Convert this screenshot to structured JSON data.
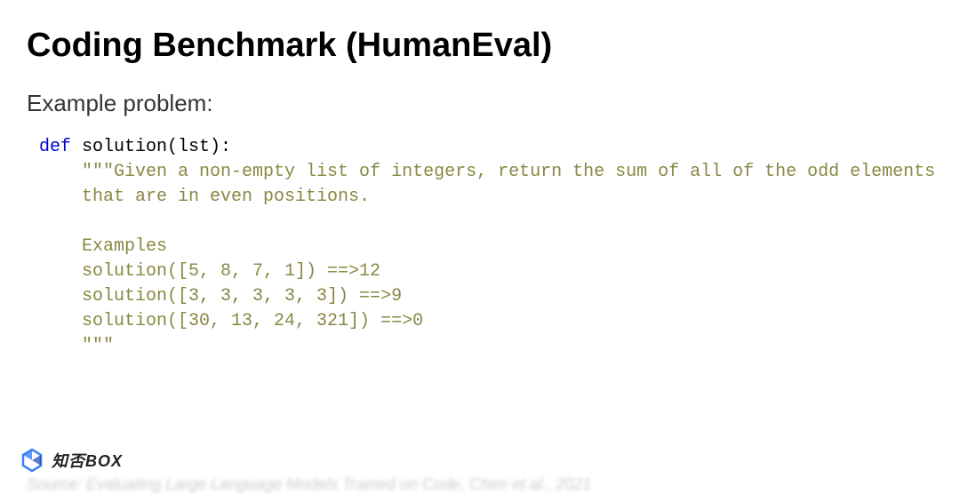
{
  "slide": {
    "title": "Coding Benchmark (HumanEval)",
    "subtitle": "Example problem:",
    "code": {
      "def_kw": "def",
      "func_name": " solution(lst):",
      "doc_open": "    \"\"\"",
      "doc_line1": "Given a non-empty list of integers, return the sum of all of the odd elements",
      "doc_line2": "    that are in even positions.",
      "doc_blank": "",
      "examples_label": "    Examples",
      "ex1": "    solution([5, 8, 7, 1]) ==>12",
      "ex2": "    solution([3, 3, 3, 3, 3]) ==>9",
      "ex3": "    solution([30, 13, 24, 321]) ==>0",
      "doc_close": "    \"\"\""
    }
  },
  "watermark": {
    "text": "知否BOX"
  },
  "source_line": "Source: Evaluating Large Language Models Trained on Code, Chen et al., 2021"
}
